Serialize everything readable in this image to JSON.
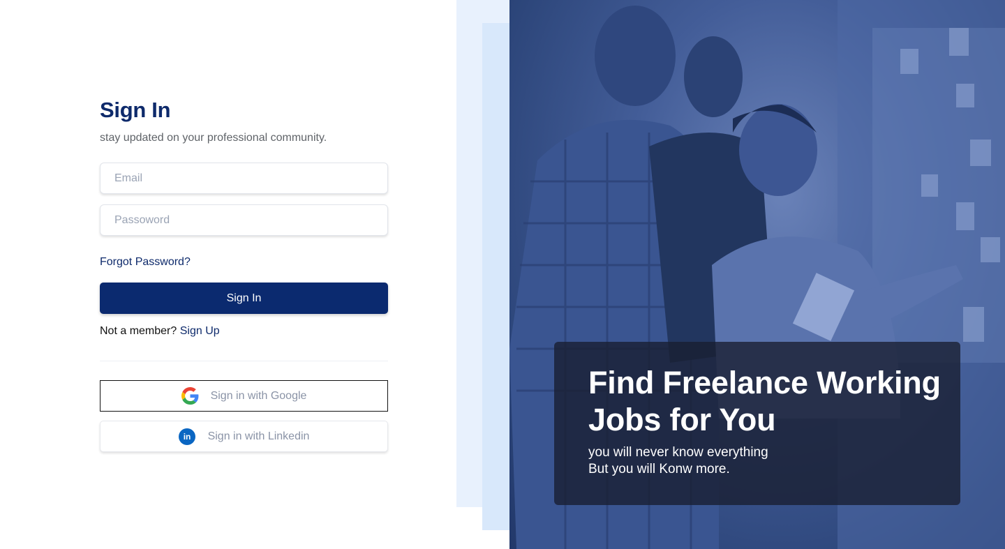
{
  "signin": {
    "title": "Sign In",
    "subtitle": "stay updated on your professional community.",
    "email_placeholder": "Email",
    "password_placeholder": "Passoword",
    "forgot_link": "Forgot Password?",
    "signin_button": "Sign In",
    "member_prompt": "Not a member?",
    "signup_link": "Sign Up",
    "google_button": "Sign in with Google",
    "google_icon": "google-g-icon",
    "linkedin_button": "Sign in with Linkedin",
    "linkedin_icon": "linkedin-icon",
    "linkedin_glyph": "in"
  },
  "hero": {
    "headline": "Find Freelance Working Jobs for You",
    "tagline_line1": "you will never know everything",
    "tagline_line2": "But you will Konw more."
  },
  "colors": {
    "primary": "#0b2a6f",
    "heading": "#0e2a6b",
    "hero_tint": "#435d98",
    "panel_light": "#e8f1fd",
    "linkedin": "#0a66c2"
  }
}
